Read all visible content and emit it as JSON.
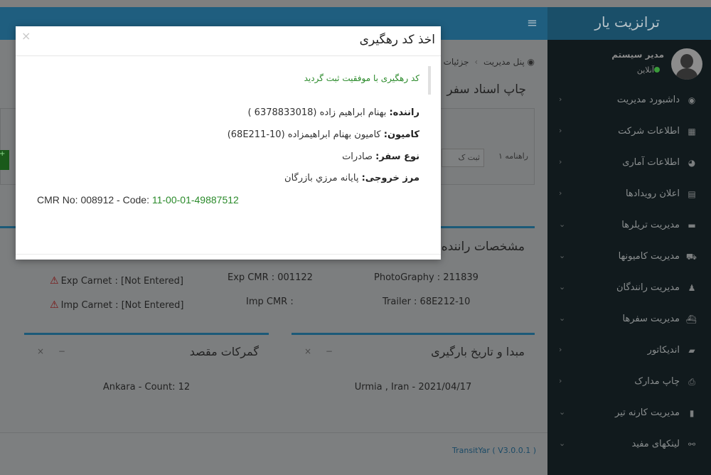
{
  "app": {
    "brand": "ترانزیت یار",
    "user_name": "مدیر سیستم",
    "user_status": "آنلاین"
  },
  "sidebar": {
    "items": [
      {
        "label": "داشبورد مدیریت",
        "icon": "dashboard-icon",
        "glyph": "◉",
        "chev": "‹"
      },
      {
        "label": "اطلاعات شرکت",
        "icon": "building-icon",
        "glyph": "▦",
        "chev": "‹"
      },
      {
        "label": "اطلاعات آماری",
        "icon": "pie-chart-icon",
        "glyph": "◕",
        "chev": "‹"
      },
      {
        "label": "اعلان رویدادها",
        "icon": "calendar-icon",
        "glyph": "▤",
        "chev": "‹"
      },
      {
        "label": "مدیریت تریلرها",
        "icon": "trailer-icon",
        "glyph": "▬",
        "chev": "⌄"
      },
      {
        "label": "مدیریت کامیونها",
        "icon": "truck-icon",
        "glyph": "⛟",
        "chev": "⌄"
      },
      {
        "label": "مدیریت رانندگان",
        "icon": "driver-icon",
        "glyph": "♟",
        "chev": "⌄"
      },
      {
        "label": "مدیریت سفرها",
        "icon": "bus-icon",
        "glyph": "⛴",
        "chev": "⌄"
      },
      {
        "label": "اندیکاتور",
        "icon": "folder-icon",
        "glyph": "▰",
        "chev": "‹"
      },
      {
        "label": "چاپ مدارک",
        "icon": "print-icon",
        "glyph": "⎙",
        "chev": "‹"
      },
      {
        "label": "مدیریت کارنه تیر",
        "icon": "file-icon",
        "glyph": "▮",
        "chev": "⌄"
      },
      {
        "label": "لینکهای مفید",
        "icon": "link-icon",
        "glyph": "⚯",
        "chev": "⌄"
      }
    ]
  },
  "breadcrumb": {
    "home": "پنل مدیریت",
    "current": "جزئیات"
  },
  "page": {
    "doc_title": "چاپ اسناد سفر",
    "tab1": "راهنامه ۱",
    "tab2": "ثبت ک",
    "driver_section": "مشخصات راننده",
    "exp_carnet": "Exp Carnet : [Not Entered]",
    "imp_carnet": "Imp Carnet : [Not Entered]",
    "exp_cmr": "Exp CMR : 001122",
    "imp_cmr": "Imp CMR :",
    "photography": "PhotoGraphy : 211839",
    "trailer": "Trailer : 68E212-10",
    "panel_customs_title": "گمرکات مقصد",
    "panel_customs_body": "Ankara - Count: 12",
    "panel_origin_title": "مبدا و تاریخ بارگیری",
    "panel_origin_body": "Urmia , Iran - 2021/04/17",
    "version": "TransitYar ( V3.0.0.1 )"
  },
  "modal": {
    "title": "اخذ کد رهگیری",
    "close": "×",
    "success": "کد رهگیری با موفقیت ثبت گردید",
    "driver_label": "راننده:",
    "driver_value": "بهنام ابراهیم زاده (6378833018 )",
    "truck_label": "کامیون:",
    "truck_value": "کامیون بهنام ابراهیمزاده (68E211-10)",
    "trip_label": "نوع سفر:",
    "trip_value": "صادرات",
    "border_label": "مرز خروجی:",
    "border_value": "پایانه مرزي بازرگان",
    "cmr_prefix": "CMR No: 008912 - Code: ",
    "cmr_code": "11-00-01-49887512"
  },
  "colors": {
    "accent": "#1f5e7f",
    "success": "#2a8a2a",
    "sidebar_bg": "#111a1d"
  }
}
